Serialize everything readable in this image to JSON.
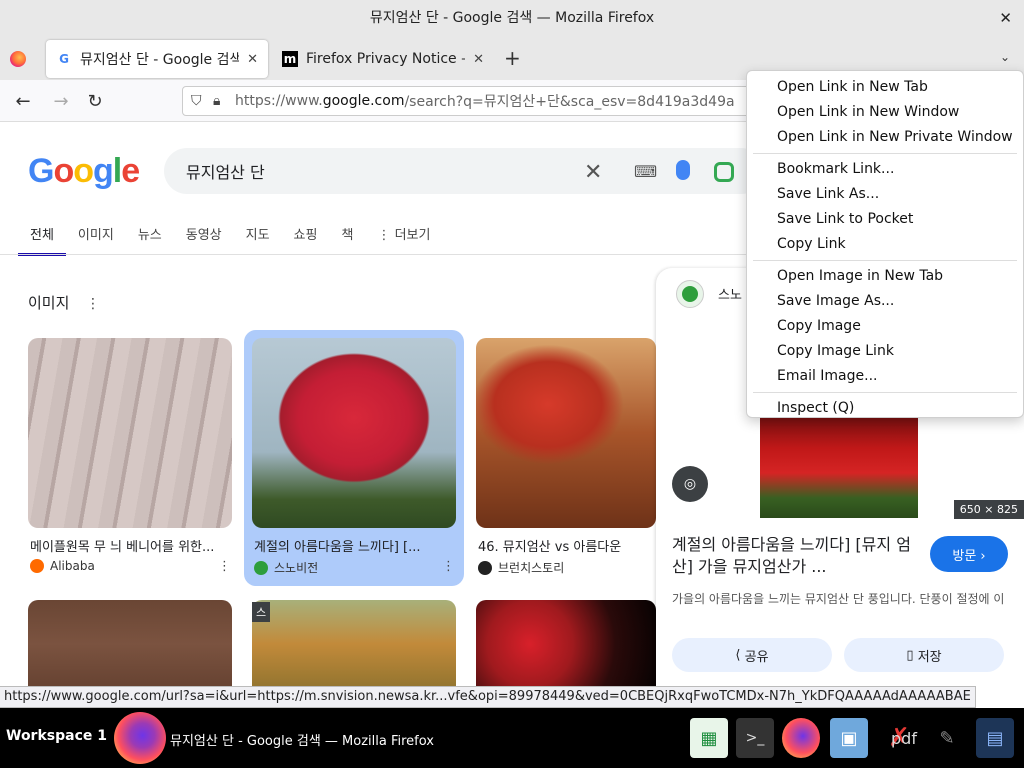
{
  "window": {
    "title": "뮤지엄산 단 - Google 검색 — Mozilla Firefox",
    "close": "✕"
  },
  "tabs": [
    {
      "title": "뮤지엄산 단 - Google 검색",
      "close": "✕"
    },
    {
      "title": "Firefox Privacy Notice —",
      "close": "✕"
    }
  ],
  "newtab": "+",
  "tablist": "⌄",
  "nav": {
    "url_prefix": "https://www.",
    "url_domain": "google.com",
    "url_rest": "/search?q=뮤지엄산+단&sca_esv=8d419a3d49a"
  },
  "google": {
    "logo": "Google",
    "query": "뮤지엄산 단",
    "tabs": [
      "전체",
      "이미지",
      "뉴스",
      "동영상",
      "지도",
      "쇼핑",
      "책",
      "더보기"
    ],
    "section_title": "이미지",
    "results": [
      {
        "caption": "메이플원목 무 늬 베니어를 위한...",
        "source": "Alibaba"
      },
      {
        "caption": "계절의 아름다움을 느끼다] [...",
        "source": "스노비전"
      },
      {
        "caption": "46. 뮤지엄산 vs 아름다운",
        "source": "브런치스토리"
      }
    ],
    "badge": "스"
  },
  "preview": {
    "brand": "스노",
    "dims": "650 × 825",
    "title": "계절의 아름다움을 느끼다] [뮤지 엄 산] 가을 뮤지엄산가 ...",
    "visit": "방문 ›",
    "desc": "가을의 아름다움을 느끼는 뮤지엄산 단 풍입니다. 단풍이 절정에 이",
    "share": "공유",
    "save": "저장"
  },
  "context_menu": {
    "group1": [
      "Open Link in New Tab",
      "Open Link in New Window",
      "Open Link in New Private Window"
    ],
    "group2": [
      "Bookmark Link...",
      "Save Link As...",
      "Save Link to Pocket",
      "Copy Link"
    ],
    "group3": [
      "Open Image in New Tab",
      "Save Image As...",
      "Copy Image",
      "Copy Image Link",
      "Email Image..."
    ],
    "group4": [
      "Inspect (Q)"
    ]
  },
  "status_url": "https://www.google.com/url?sa=i&url=https://m.snvision.newsa.kr...vfe&opi=89978449&ved=0CBEQjRxqFwoTCMDx-N7h_YkDFQAAAAAdAAAAABAE",
  "taskbar": {
    "workspace": "Workspace 1",
    "window_title": "뮤지엄산 단 - Google 검색 — Mozilla Firefox",
    "pdf": "pdf"
  },
  "colors": {
    "link_blue": "#1a73e8",
    "selected_card": "#aecbfa"
  }
}
